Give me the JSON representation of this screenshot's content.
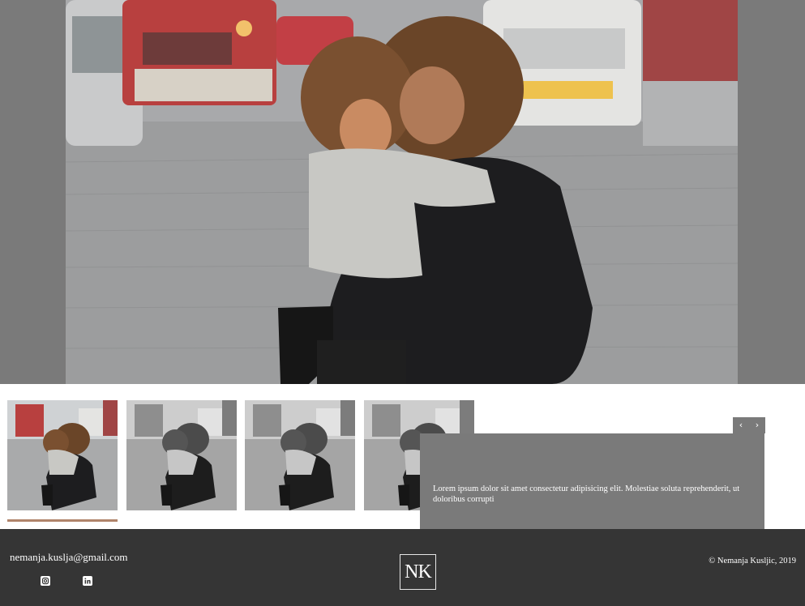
{
  "hero": {
    "image_alt": "mother-and-daughter-photo"
  },
  "gallery": {
    "thumbnails": [
      {
        "name": "thumbnail-1",
        "state": "color",
        "active": true
      },
      {
        "name": "thumbnail-2",
        "state": "grayscale",
        "active": false
      },
      {
        "name": "thumbnail-3",
        "state": "grayscale",
        "active": false
      },
      {
        "name": "thumbnail-4",
        "state": "grayscale",
        "active": false
      }
    ],
    "prev_label": "‹",
    "next_label": "›",
    "caption": "Lorem ipsum dolor sit amet consectetur adipisicing elit. Molestiae soluta reprehenderit, ut doloribus corrupti"
  },
  "footer": {
    "email": "nemanja.kuslja@gmail.com",
    "social": [
      {
        "icon": "instagram-icon"
      },
      {
        "icon": "linkedin-icon"
      }
    ],
    "logo": "NK",
    "copyright": "© Nemanja Kusljic, 2019"
  },
  "colors": {
    "panel_gray": "#7a7a7a",
    "footer_dark": "#353535",
    "active_accent": "#b0846b"
  }
}
